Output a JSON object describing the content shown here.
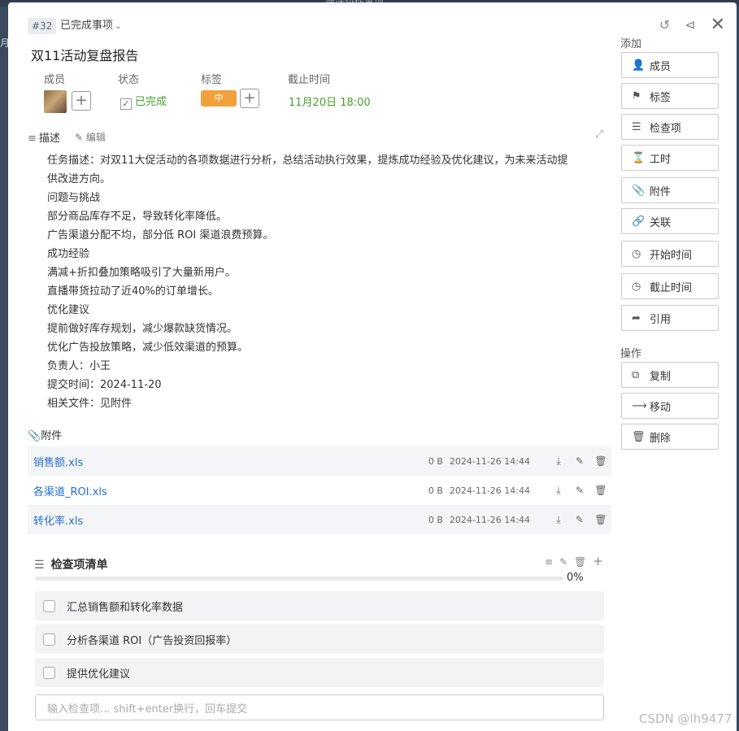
{
  "background": {
    "top_text": "筛选协作事项",
    "left_text": "月"
  },
  "header": {
    "issue_id": "#32",
    "status_dropdown": "已完成事项",
    "title": "双11活动复盘报告"
  },
  "meta": {
    "members_label": "成员",
    "status_label": "状态",
    "status_value": "已完成",
    "tags_label": "标签",
    "tag_value": "中",
    "deadline_label": "截止时间",
    "deadline_value": "11月20日 18:00"
  },
  "description": {
    "label": "描述",
    "edit_label": "编辑",
    "lines": [
      "任务描述：对双11大促活动的各项数据进行分析，总结活动执行效果，提炼成功经验及优化建议，为未来活动提",
      "供改进方向。",
      "问题与挑战",
      "部分商品库存不足，导致转化率降低。",
      "广告渠道分配不均，部分低 ROI 渠道浪费预算。",
      "成功经验",
      "满减+折扣叠加策略吸引了大量新用户。",
      "直播带货拉动了近40%的订单增长。",
      "优化建议",
      "提前做好库存规划，减少爆款缺货情况。",
      "优化广告投放策略，减少低效渠道的预算。",
      "负责人：小王",
      "提交时间：2024-11-20",
      "相关文件：见附件"
    ]
  },
  "attachments": {
    "label": "附件",
    "files": [
      {
        "name": "销售额.xls",
        "size": "0 B",
        "time": "2024-11-26 14:44"
      },
      {
        "name": "各渠道_ROI.xls",
        "size": "0 B",
        "time": "2024-11-26 14:44"
      },
      {
        "name": "转化率.xls",
        "size": "0 B",
        "time": "2024-11-26 14:44"
      }
    ]
  },
  "checklist": {
    "title": "检查项清单",
    "progress_text": "0%",
    "progress_fraction": 0,
    "items": [
      "汇总销售额和转化率数据",
      "分析各渠道 ROI（广告投资回报率）",
      "提供优化建议"
    ],
    "input_placeholder": "输入检查项... shift+enter换行，回车提交"
  },
  "sidebar": {
    "add_label": "添加",
    "add_buttons": [
      "成员",
      "标签",
      "检查项",
      "工时",
      "附件",
      "关联",
      "开始时间",
      "截止时间",
      "引用"
    ],
    "ops_label": "操作",
    "op_buttons": [
      "复制",
      "移动",
      "删除"
    ]
  },
  "watermark": "CSDN @lh9477",
  "colors": {
    "accent_green": "#4aa02c",
    "tag_orange": "#f0a13a",
    "link_blue": "#2a6fc9"
  }
}
